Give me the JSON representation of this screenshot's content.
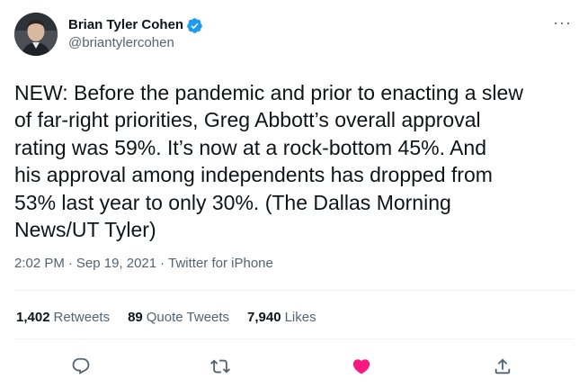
{
  "author": {
    "display_name": "Brian Tyler Cohen",
    "handle": "@briantylercohen",
    "verified": true
  },
  "menu": {
    "more_icon": "more-horizontal-icon",
    "glyph": "···"
  },
  "tweet": {
    "text": "NEW: Before the pandemic and prior to enacting a slew\nof far-right priorities, Greg Abbott’s overall approval\nrating was 59%. It’s now at a rock-bottom 45%. And\nhis approval among independents has dropped from\n53% last year to only 30%. (The Dallas Morning\nNews/UT Tyler)",
    "time": "2:02 PM",
    "date": "Sep 19, 2021",
    "source": "Twitter for iPhone"
  },
  "stats": {
    "retweets_count": "1,402",
    "retweets_label": "Retweets",
    "quotes_count": "89",
    "quotes_label": "Quote Tweets",
    "likes_count": "7,940",
    "likes_label": "Likes"
  },
  "actions": {
    "reply_icon": "reply-icon",
    "retweet_icon": "retweet-icon",
    "like_icon": "heart-icon",
    "liked": true,
    "share_icon": "share-icon"
  },
  "colors": {
    "text_primary": "#0f1419",
    "text_secondary": "#536471",
    "verified_blue": "#1d9bf0",
    "like_pink": "#f91880",
    "divider": "#eff3f4"
  }
}
